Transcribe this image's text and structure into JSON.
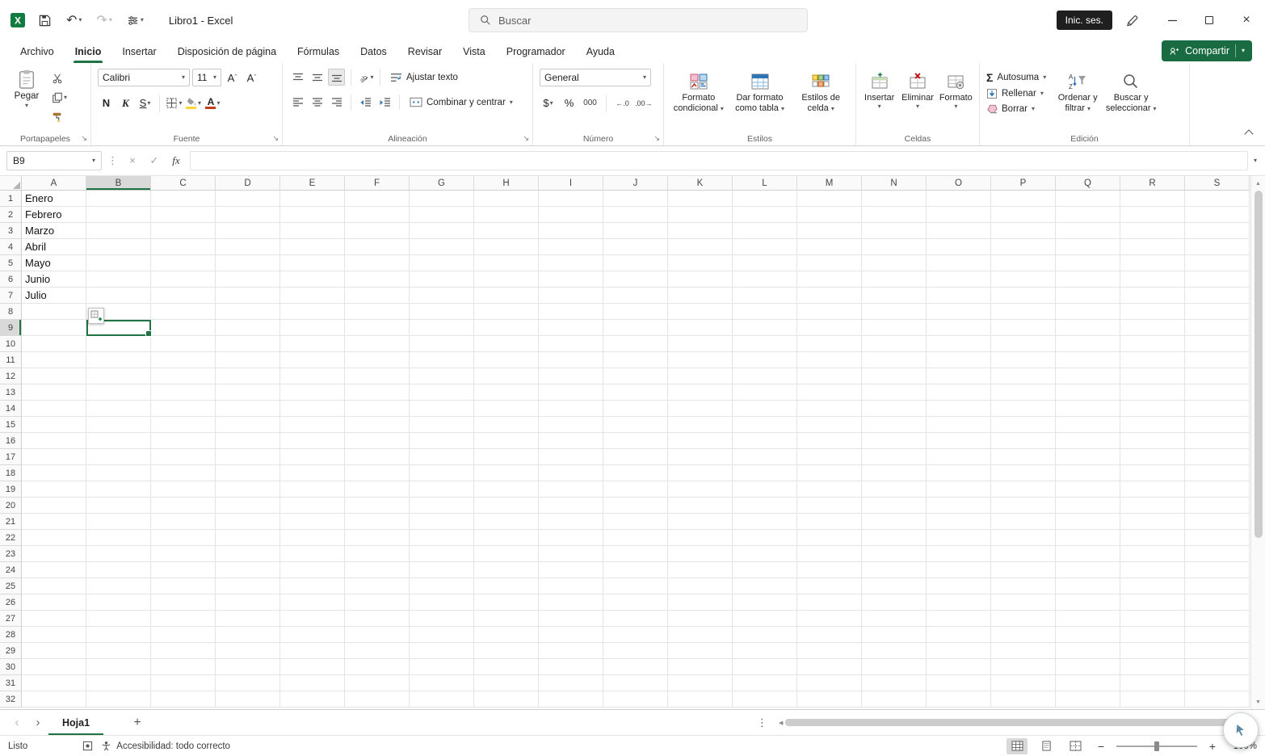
{
  "colors": {
    "accent": "#217346",
    "share": "#196c41",
    "signin": "#1f1f1f",
    "excel": "#107c41",
    "yellow": "#ffd43b",
    "red": "#c43e1c"
  },
  "titlebar": {
    "doc_title": "Libro1 - Excel",
    "search_placeholder": "Buscar",
    "sign_in": "Inic. ses."
  },
  "tabs": [
    "Archivo",
    "Inicio",
    "Insertar",
    "Disposición de página",
    "Fórmulas",
    "Datos",
    "Revisar",
    "Vista",
    "Programador",
    "Ayuda"
  ],
  "share": {
    "label": "Compartir"
  },
  "ribbon": {
    "clipboard": {
      "paste": "Pegar",
      "group": "Portapapeles"
    },
    "font": {
      "family": "Calibri",
      "size": "11",
      "bold": "N",
      "italic": "K",
      "underline": "S",
      "color_letter": "A",
      "group": "Fuente"
    },
    "alignment": {
      "wrap": "Ajustar texto",
      "merge": "Combinar y centrar",
      "group": "Alineación"
    },
    "number": {
      "format": "General",
      "currency": "$",
      "percent": "%",
      "thousands": "000",
      "inc_dec": "←.0",
      "dec_dec": ".00→",
      "group": "Número"
    },
    "styles": {
      "cond1": "Formato",
      "cond2": "condicional",
      "table1": "Dar formato",
      "table2": "como tabla",
      "cell1": "Estilos de",
      "cell2": "celda",
      "group": "Estilos"
    },
    "cells": {
      "insert": "Insertar",
      "remove": "Eliminar",
      "format": "Formato",
      "group": "Celdas"
    },
    "editing": {
      "autosum": "Autosuma",
      "fill": "Rellenar",
      "clear": "Borrar",
      "sort1": "Ordenar y",
      "sort2": "filtrar",
      "find1": "Buscar y",
      "find2": "seleccionar",
      "group": "Edición"
    }
  },
  "formula_bar": {
    "name_box": "B9",
    "formula": ""
  },
  "grid": {
    "columns": [
      "A",
      "B",
      "C",
      "D",
      "E",
      "F",
      "G",
      "H",
      "I",
      "J",
      "K",
      "L",
      "M",
      "N",
      "O",
      "P",
      "Q",
      "R",
      "S"
    ],
    "rows": 32,
    "cells": {
      "A1": "Enero",
      "A2": "Febrero",
      "A3": "Marzo",
      "A4": "Abril",
      "A5": "Mayo",
      "A6": "Junio",
      "A7": "Julio"
    },
    "selected": "B9",
    "selected_col": "B",
    "selected_row": 9
  },
  "sheet_bar": {
    "active_tab": "Hoja1"
  },
  "status_bar": {
    "mode": "Listo",
    "accessibility": "Accesibilidad: todo correcto",
    "zoom": "100%"
  }
}
